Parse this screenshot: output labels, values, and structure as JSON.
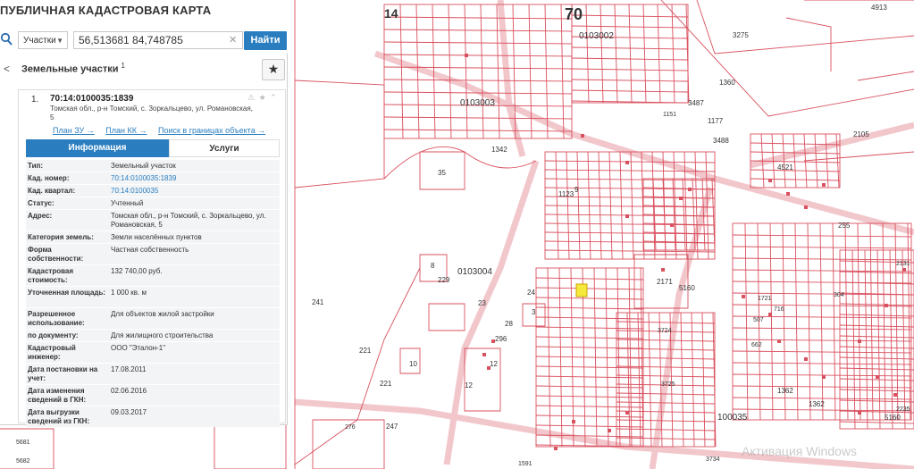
{
  "app": {
    "title": "ПУБЛИЧНАЯ КАДАСТРОВАЯ КАРТА"
  },
  "search": {
    "scope": "Участки",
    "query": "56,513681 84,748785",
    "button": "Найти"
  },
  "panel": {
    "title": "Земельные участки",
    "title_sup": "1"
  },
  "parcel": {
    "index": "1.",
    "number": "70:14:0100035:1839",
    "address": "Томская обл., р-н Томский, с. Зоркальцево, ул. Романовская, 5",
    "links": [
      "План ЗУ →",
      "План КК →",
      "Поиск в границах объекта →"
    ],
    "tabs": [
      "Информация",
      "Услуги"
    ],
    "rows": [
      {
        "k": "Тип:",
        "v": "Земельный участок",
        "h": 14
      },
      {
        "k": "Кад. номер:",
        "v": "70:14:0100035:1839",
        "h": 14,
        "link": true
      },
      {
        "k": "Кад. квартал:",
        "v": "70:14:0100035",
        "h": 14,
        "link": true
      },
      {
        "k": "Статус:",
        "v": "Учтенный",
        "h": 14
      },
      {
        "k": "Адрес:",
        "v": "Томская обл., р-н Томский, с. Зоркальцево, ул. Романовская, 5",
        "h": 24
      },
      {
        "k": "Категория земель:",
        "v": "Земли населённых пунктов",
        "h": 14
      },
      {
        "k": "Форма собственности:",
        "v": "Частная собственность",
        "h": 24
      },
      {
        "k": "Кадастровая стоимость:",
        "v": "132 740,00 руб.",
        "h": 24
      },
      {
        "k": "Уточненная площадь:",
        "v": "1 000 кв. м",
        "h": 24
      },
      {
        "k": "Разрешенное использование:",
        "v": "Для объектов жилой застройки",
        "h": 24
      },
      {
        "k": "по документу:",
        "v": "Для жилищного строительства",
        "h": 14
      },
      {
        "k": "Кадастровый инженер:",
        "v": "ООО \"Эталон-1\"",
        "h": 24
      },
      {
        "k": "Дата постановки на учет:",
        "v": "17.08.2011",
        "h": 24
      },
      {
        "k": "Дата изменения сведений в ГКН:",
        "v": "02.06.2016",
        "h": 24
      },
      {
        "k": "Дата выгрузки сведений из ГКН:",
        "v": "09.03.2017",
        "h": 24
      }
    ]
  },
  "map_labels": [
    "14",
    "70",
    "0103002",
    "0103003",
    "0103004",
    "100035",
    "4913",
    "3275",
    "1360",
    "1177",
    "3487",
    "3488",
    "2105",
    "4521",
    "2171",
    "5160",
    "5160",
    "1362",
    "1362",
    "255",
    "35",
    "1342",
    "1123",
    "9",
    "8",
    "229",
    "24",
    "23",
    "28",
    "3",
    "296",
    "10",
    "12",
    "12",
    "221",
    "221",
    "241",
    "247",
    "276",
    "5681",
    "5682",
    "1591",
    "3734",
    "3725",
    "3724",
    "2131",
    "2235",
    "1721",
    "716",
    "304",
    "507",
    "662",
    "1151",
    "1349",
    "139"
  ],
  "colors": {
    "accent": "#2a7ec0",
    "parcel_line": "#d9505f",
    "selected_parcel": "#f5ea3b"
  },
  "watermark": "Активация Windows"
}
